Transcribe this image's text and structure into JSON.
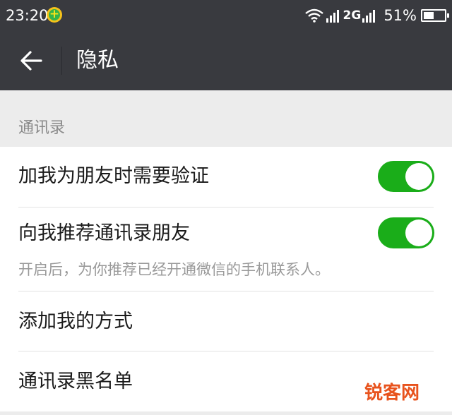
{
  "status_bar": {
    "time": "23:20",
    "network_type": "2G",
    "battery_percent": "51%",
    "battery_level": 0.51
  },
  "header": {
    "title": "隐私"
  },
  "section": {
    "title": "通讯录"
  },
  "settings": {
    "verify_friend": {
      "label": "加我为朋友时需要验证",
      "enabled": true
    },
    "recommend_contacts": {
      "label": "向我推荐通讯录朋友",
      "description": "开启后，为你推荐已经开通微信的手机联系人。",
      "enabled": true
    },
    "add_me_methods": {
      "label": "添加我的方式"
    },
    "contacts_blacklist": {
      "label": "通讯录黑名单"
    }
  },
  "watermark": {
    "text": "锐客网"
  },
  "colors": {
    "bar_background": "#393a3f",
    "toggle_on": "#1aad19",
    "page_background": "#ececec",
    "watermark": "#e8531d"
  }
}
